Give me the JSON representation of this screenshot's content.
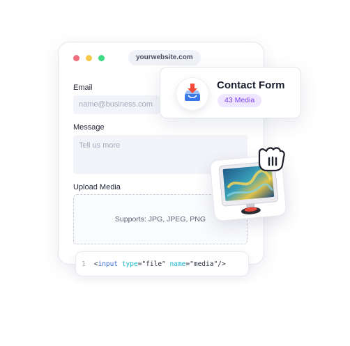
{
  "browser": {
    "url": "yourwebsite.com"
  },
  "form": {
    "email_label": "Email",
    "email_placeholder": "name@business.com",
    "message_label": "Message",
    "message_placeholder": "Tell us more",
    "upload_label": "Upload Media",
    "upload_hint": "Supports: JPG, JPEG, PNG"
  },
  "code": {
    "line_number": "1",
    "open": "<",
    "tag": "input",
    "attr1": "type",
    "eq1": "=",
    "val1": "\"file\"",
    "attr2": "name",
    "eq2": "=",
    "val2": "\"media\"",
    "close": "/>"
  },
  "contact_card": {
    "title": "Contact Form",
    "badge": "43 Media"
  },
  "icons": [
    "inbox-tray-icon",
    "monitor-image-icon",
    "cursor-hand-icon"
  ],
  "colors": {
    "accent_purple": "#7a3ff0",
    "badge_bg": "#efe6ff",
    "dot_red": "#f1707f",
    "dot_yellow": "#f6c94a",
    "dot_green": "#3ddc84"
  }
}
